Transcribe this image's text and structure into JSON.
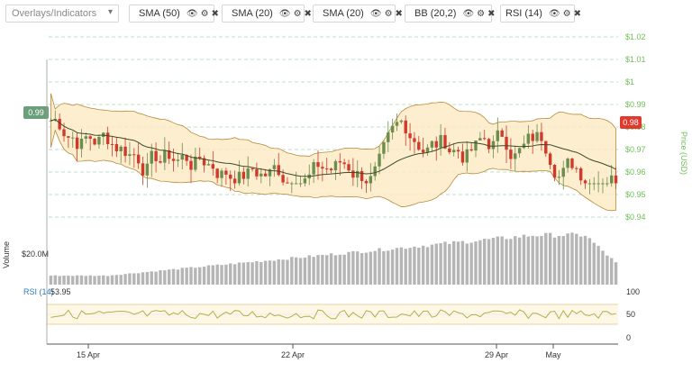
{
  "toolbar": {
    "overlay_placeholder": "Overlays/Indicators",
    "indicators": [
      {
        "label": "SMA (50)",
        "color": "#7e4fc1"
      },
      {
        "label": "SMA (20)",
        "color": "#2e7bbf"
      },
      {
        "label": "SMA (20)",
        "color": "#4caf50"
      },
      {
        "label": "BB (20,2)",
        "color": "#f5c242"
      },
      {
        "label": "RSI (14)",
        "color": "#ffffff"
      }
    ]
  },
  "chart_data": {
    "type": "candlestick",
    "price_axis": {
      "label": "Price (USD)",
      "ticks": [
        "$1.02",
        "$1.01",
        "$1",
        "$0.99",
        "$0.98",
        "$0.97",
        "$0.96",
        "$0.95",
        "$0.94"
      ],
      "ylim": [
        0.935,
        1.02
      ]
    },
    "current_price_left": "0.99",
    "current_price_right": "0.98",
    "volume_axis": {
      "label": "Volume",
      "tick": "$20.0M"
    },
    "rsi": {
      "label": "RSI (14)",
      "value": "53.95",
      "ticks": [
        "100",
        "50",
        "0"
      ],
      "bands": [
        30,
        70
      ]
    },
    "x_ticks": [
      "15 Apr",
      "22 Apr",
      "29 Apr",
      "May"
    ],
    "candle_count": 130,
    "colors": {
      "up": "#6b8e4e",
      "down": "#d13a2a",
      "band_fill": "#fcebc6",
      "band_line": "#b88a3a",
      "sma_line": "#3d4a2a",
      "volume": "#b5b5b5",
      "rsi_line": "#b6ad4a",
      "grid": "#a8d8b8",
      "price_tag_left": "#6b9e7b",
      "price_tag_right": "#e03a2e"
    }
  }
}
